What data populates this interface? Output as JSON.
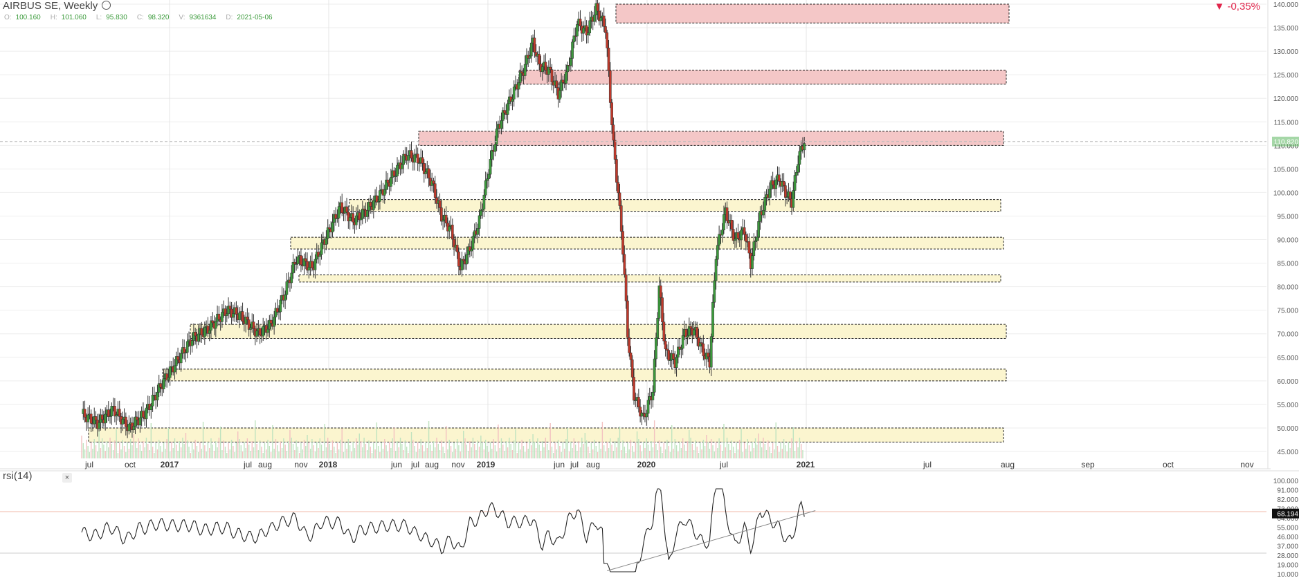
{
  "header": {
    "title": "AIRBUS SE, Weekly",
    "change": "-0,35%",
    "ohlc": [
      {
        "k": "O:",
        "v": "100.160"
      },
      {
        "k": "H:",
        "v": "101.060"
      },
      {
        "k": "L:",
        "v": "95.830"
      },
      {
        "k": "C:",
        "v": "98.320"
      },
      {
        "k": "V:",
        "v": "9361634"
      },
      {
        "k": "D:",
        "v": "2021-05-06"
      }
    ]
  },
  "colors": {
    "up": "#3c9a3c",
    "down": "#c0392b",
    "resistance": "#f4c7c7",
    "support": "#fbf5cf",
    "accent": "#e0254b"
  },
  "indicator": {
    "label": "rsi(14)",
    "close": "×",
    "last": "68.194"
  },
  "chart_data": [
    {
      "type": "candlestick",
      "title": "AIRBUS SE, Weekly",
      "ylim": [
        45,
        140
      ],
      "y_ticks": [
        "45.000",
        "50.000",
        "55.000",
        "60.000",
        "65.000",
        "70.000",
        "75.000",
        "80.000",
        "85.000",
        "90.000",
        "95.000",
        "100.000",
        "105.000",
        "110.000",
        "115.000",
        "120.000",
        "125.000",
        "130.000",
        "135.000",
        "140.000"
      ],
      "x_labels": [
        "jul",
        "oct",
        "2017",
        "jul",
        "aug",
        "nov",
        "2018",
        "jun",
        "jul",
        "aug",
        "nov",
        "2019",
        "jun",
        "jul",
        "aug",
        "2020",
        "jul",
        "2021",
        "jul",
        "aug",
        "sep",
        "oct",
        "nov"
      ],
      "last_price_label": "110.820",
      "resistance_zones": [
        [
          136,
          140
        ],
        [
          123,
          126
        ],
        [
          110,
          113
        ]
      ],
      "support_zones": [
        [
          96,
          98.5
        ],
        [
          88,
          90.5
        ],
        [
          81,
          82.5
        ],
        [
          69,
          72
        ],
        [
          60,
          62.5
        ],
        [
          47,
          50
        ]
      ],
      "close_path": [
        [
          0,
          53
        ],
        [
          10,
          51
        ],
        [
          20,
          54
        ],
        [
          30,
          50
        ],
        [
          40,
          53
        ],
        [
          52,
          60
        ],
        [
          62,
          65
        ],
        [
          70,
          69
        ],
        [
          80,
          71
        ],
        [
          92,
          75
        ],
        [
          100,
          74
        ],
        [
          112,
          70
        ],
        [
          120,
          72
        ],
        [
          128,
          78
        ],
        [
          136,
          86
        ],
        [
          146,
          84
        ],
        [
          154,
          90
        ],
        [
          164,
          97
        ],
        [
          172,
          94
        ],
        [
          180,
          96
        ],
        [
          188,
          99
        ],
        [
          200,
          105
        ],
        [
          206,
          108
        ],
        [
          214,
          107
        ],
        [
          222,
          102
        ],
        [
          228,
          95
        ],
        [
          234,
          92
        ],
        [
          240,
          84
        ],
        [
          246,
          88
        ],
        [
          252,
          94
        ],
        [
          258,
          105
        ],
        [
          264,
          114
        ],
        [
          272,
          120
        ],
        [
          280,
          126
        ],
        [
          286,
          132
        ],
        [
          290,
          127
        ],
        [
          296,
          126
        ],
        [
          302,
          121
        ],
        [
          308,
          126
        ],
        [
          314,
          136
        ],
        [
          320,
          134
        ],
        [
          326,
          139
        ],
        [
          332,
          135
        ],
        [
          334,
          125
        ],
        [
          337,
          110
        ],
        [
          340,
          100
        ],
        [
          343,
          88
        ],
        [
          346,
          70
        ],
        [
          350,
          57
        ],
        [
          356,
          52
        ],
        [
          362,
          58
        ],
        [
          366,
          80
        ],
        [
          370,
          66
        ],
        [
          376,
          64
        ],
        [
          382,
          70
        ],
        [
          388,
          71
        ],
        [
          394,
          66
        ],
        [
          398,
          64
        ],
        [
          402,
          87
        ],
        [
          408,
          96
        ],
        [
          414,
          90
        ],
        [
          420,
          92
        ],
        [
          424,
          85
        ],
        [
          430,
          95
        ],
        [
          436,
          101
        ],
        [
          442,
          103
        ],
        [
          446,
          100
        ],
        [
          450,
          98
        ],
        [
          454,
          107
        ],
        [
          458,
          111
        ]
      ],
      "volume_max": 1
    },
    {
      "type": "line",
      "name": "rsi(14)",
      "ylim": [
        10,
        100
      ],
      "y_ticks": [
        "10.000",
        "19.000",
        "28.000",
        "37.000",
        "46.000",
        "55.000",
        "64.000",
        "73.000",
        "82.000",
        "91.000",
        "100.000"
      ],
      "overbought": 70,
      "oversold": 30,
      "trendline": [
        [
          333,
          13
        ],
        [
          465,
          71
        ]
      ]
    }
  ]
}
